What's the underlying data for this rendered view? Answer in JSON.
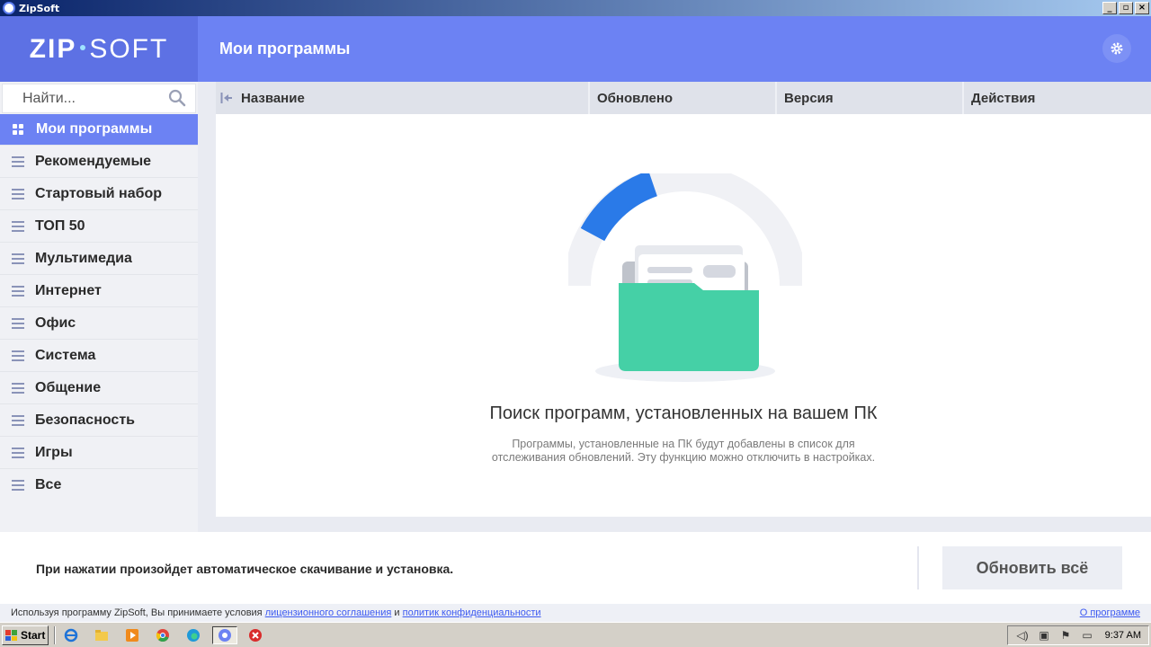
{
  "window": {
    "title": "ZipSoft",
    "buttons": [
      "_",
      "▫",
      "×"
    ]
  },
  "header": {
    "logo_left": "ZIP",
    "logo_right": "SOFT",
    "page_title": "Мои программы"
  },
  "sidebar": {
    "search_placeholder": "Найти...",
    "items": [
      {
        "label": "Мои программы",
        "active": true
      },
      {
        "label": "Рекомендуемые"
      },
      {
        "label": "Стартовый набор"
      },
      {
        "label": "ТОП 50"
      },
      {
        "label": "Мультимедиа"
      },
      {
        "label": "Интернет"
      },
      {
        "label": "Офис"
      },
      {
        "label": "Система"
      },
      {
        "label": "Общение"
      },
      {
        "label": "Безопасность"
      },
      {
        "label": "Игры"
      },
      {
        "label": "Все"
      }
    ]
  },
  "table": {
    "columns": [
      "Название",
      "Обновлено",
      "Версия",
      "Действия"
    ]
  },
  "empty_state": {
    "title": "Поиск программ, установленных на вашем ПК",
    "description_line1": "Программы, установленные на ПК будут добавлены в список для",
    "description_line2": "отслеживания обновлений. Эту функцию можно отключить в настройках."
  },
  "footer": {
    "note": "При нажатии произойдет автоматическое скачивание и установка.",
    "update_all_label": "Обновить всё"
  },
  "legal": {
    "prefix": "Используя программу ZipSoft, Вы принимаете условия",
    "license_link": "лицензионного соглашения",
    "and": "и",
    "privacy_link": "политик конфиденциальности",
    "about_link": "О программе"
  },
  "taskbar": {
    "start_label": "Start",
    "clock": "9:37 AM"
  },
  "colors": {
    "accent": "#6c82f3",
    "accent_dark": "#5d71e4",
    "folder_green": "#45d0a6",
    "progress_blue": "#2a7ae8"
  },
  "icons": [
    "settings-gear-icon",
    "search-icon",
    "grid-icon",
    "list-icon",
    "collapse-icon",
    "folder-illustration"
  ]
}
